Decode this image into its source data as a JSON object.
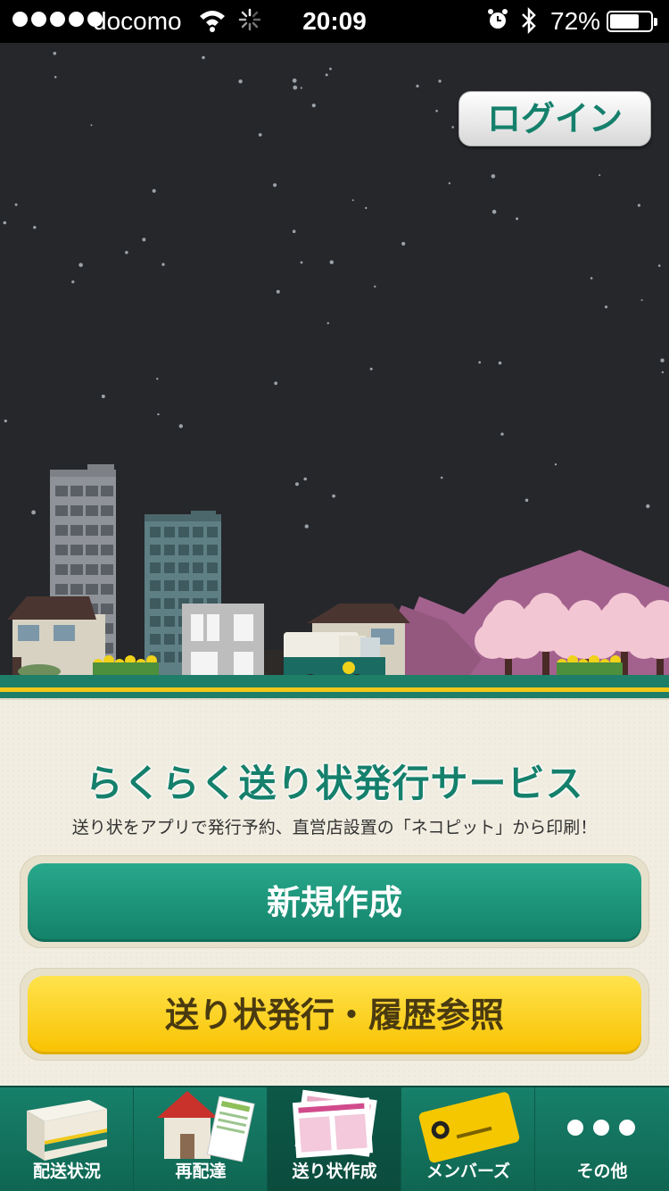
{
  "status_bar": {
    "carrier": "docomo",
    "time": "20:09",
    "battery_percent": "72%",
    "battery_level": 0.72,
    "icons": [
      "signal-dots-icon",
      "wifi-icon",
      "loading-spinner-icon",
      "alarm-icon",
      "bluetooth-icon",
      "battery-icon"
    ]
  },
  "header": {
    "login_label": "ログイン"
  },
  "main": {
    "title": "らくらく送り状発行サービス",
    "description": "送り状をアプリで発行予約、直営店設置の「ネコピット」から印刷！",
    "new_button_label": "新規作成",
    "history_button_label": "送り状発行・履歴参照"
  },
  "tabbar": {
    "tabs": [
      {
        "label": "配送状況",
        "icon": "package-box-icon",
        "active": false
      },
      {
        "label": "再配達",
        "icon": "house-icon",
        "active": false
      },
      {
        "label": "送り状作成",
        "icon": "shipping-label-icon",
        "active": true
      },
      {
        "label": "メンバーズ",
        "icon": "member-card-icon",
        "active": false
      },
      {
        "label": "その他",
        "icon": "more-dots-icon",
        "active": false
      }
    ]
  },
  "colors": {
    "brand_green": "#15806c",
    "brand_yellow": "#f9c200",
    "night_sky": "#25272b",
    "cream_background": "#f1ede1"
  }
}
